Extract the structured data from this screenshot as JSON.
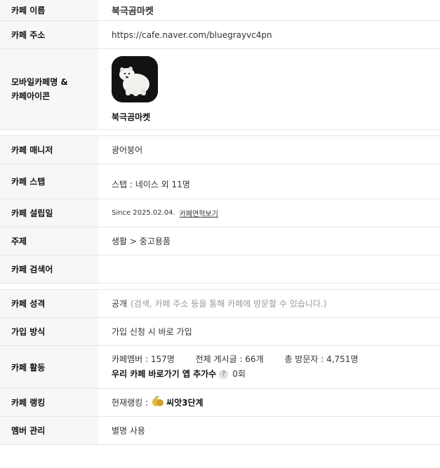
{
  "rows": {
    "name": {
      "label": "카페 이름",
      "value": "북극곰마켓"
    },
    "address": {
      "label": "카페 주소",
      "value": "https://cafe.naver.com/bluegrayvc4pn"
    },
    "mobile": {
      "label_line1": "모바일카페명 &",
      "label_line2": "카페아이콘",
      "value": "북극곰마켓"
    },
    "manager": {
      "label": "카페 매니저",
      "value": "광어붕어"
    },
    "staff": {
      "label": "카페 스탭",
      "value": "스탭 : 네이스 외 11명"
    },
    "founded": {
      "label": "카페 설립일",
      "value": "Since 2025.02.04.",
      "link": "카페연혁보기"
    },
    "topic": {
      "label": "주제",
      "value": "생활 > 중고용품"
    },
    "keywords": {
      "label": "카페 검색어",
      "value": ""
    },
    "type": {
      "label": "카페 성격",
      "value": "공개",
      "note": "(검색, 카페 주소 등을 통해 카페에 방문할 수 있습니다.)"
    },
    "join": {
      "label": "가입 방식",
      "value": "가입 신청 시 바로 가입"
    },
    "activity": {
      "label": "카페 활동",
      "members": "카페멤버 : 157명",
      "posts": "전체 게시글 : 66개",
      "visitors": "총 방문자 : 4,751명",
      "shortcut_label": "우리 카페 바로가기 앱 추가수",
      "help_icon": "?",
      "shortcut_count": "0회"
    },
    "ranking": {
      "label": "카페 랭킹",
      "prefix": "현재랭킹 :",
      "value": "씨앗3단계"
    },
    "member_mgmt": {
      "label": "멤버 관리",
      "value": "별명 사용"
    }
  },
  "icons": {
    "cafe_icon": "polar-bear-icon",
    "rank_icon": "seed-rank-icon"
  }
}
